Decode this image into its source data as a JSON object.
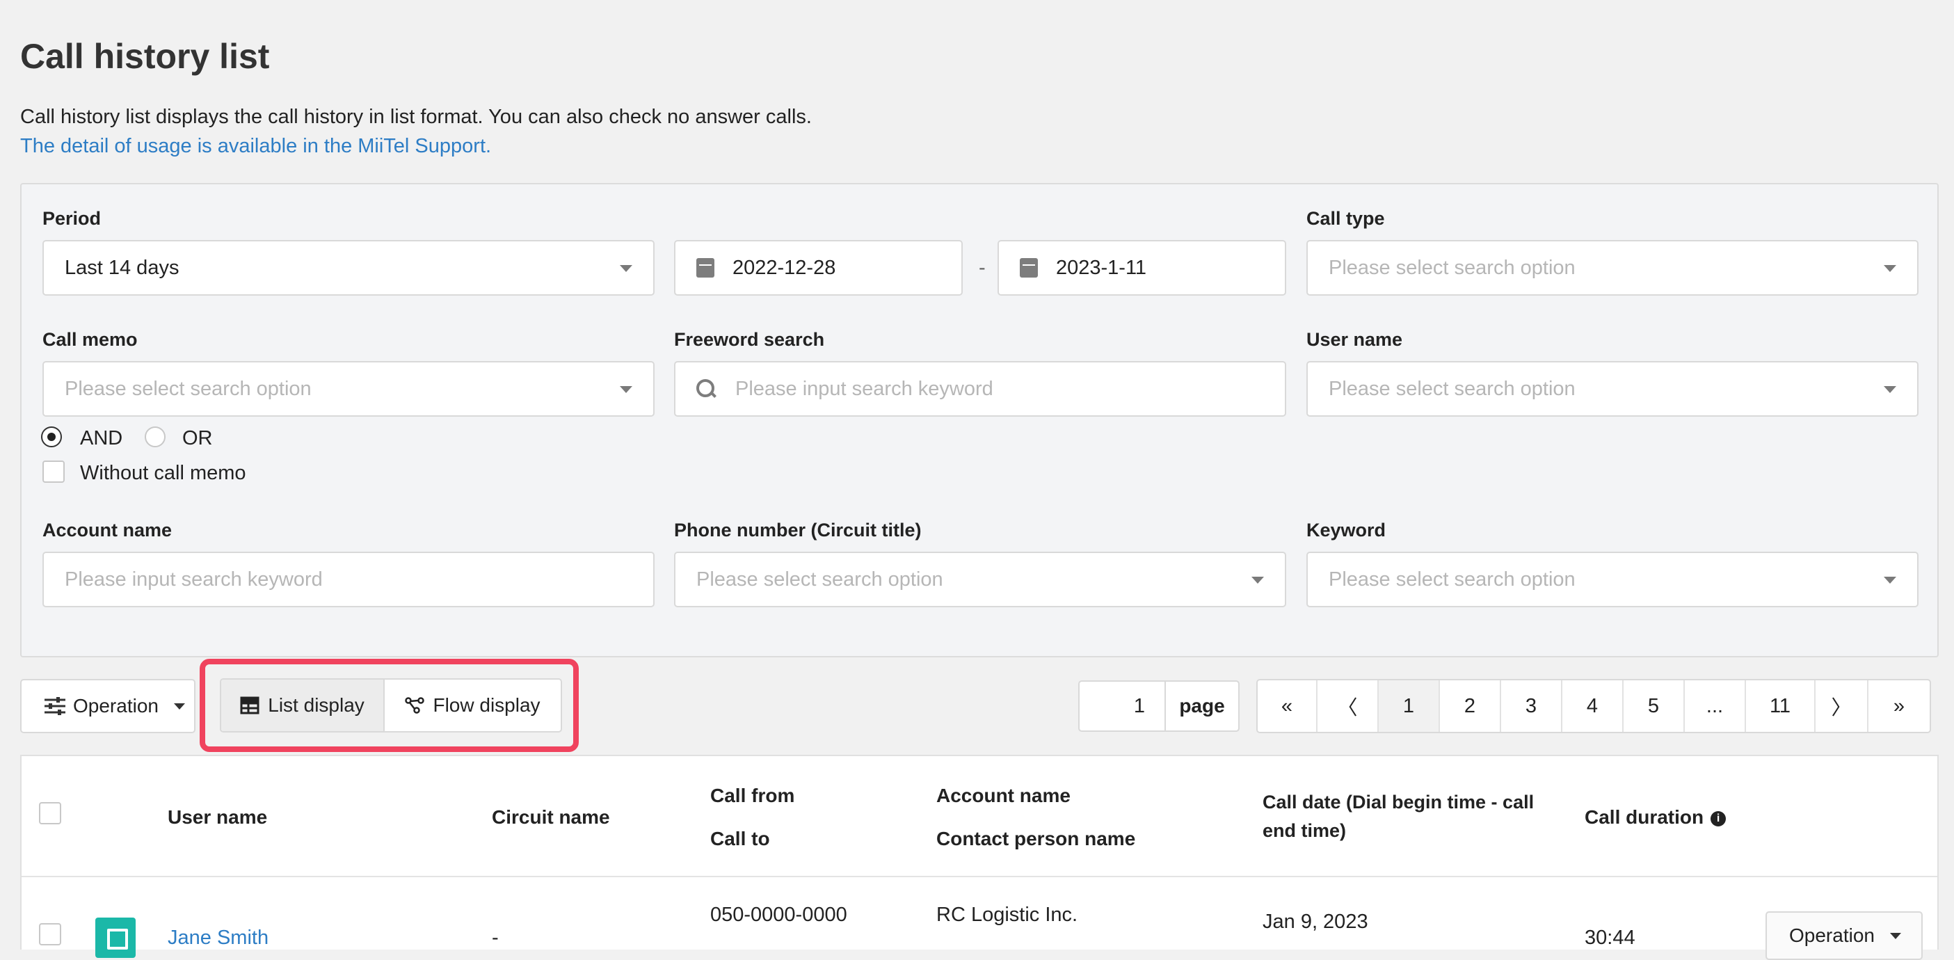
{
  "page": {
    "title": "Call history list",
    "description": "Call history list displays the call history in list format. You can also check no answer calls.",
    "support_link": "The detail of usage is available in the MiiTel Support."
  },
  "filters": {
    "period": {
      "label": "Period",
      "value": "Last 14 days"
    },
    "date_from": "2022-12-28",
    "date_separator": "-",
    "date_to": "2023-1-11",
    "call_type": {
      "label": "Call type",
      "placeholder": "Please select search option"
    },
    "call_memo": {
      "label": "Call memo",
      "placeholder": "Please select search option"
    },
    "freeword": {
      "label": "Freeword search",
      "placeholder": "Please input search keyword"
    },
    "user_name": {
      "label": "User name",
      "placeholder": "Please select search option"
    },
    "logic": {
      "and_label": "AND",
      "or_label": "OR",
      "selected": "AND"
    },
    "without_memo_label": "Without call memo",
    "account_name": {
      "label": "Account name",
      "placeholder": "Please input search keyword"
    },
    "phone_number": {
      "label": "Phone number (Circuit title)",
      "placeholder": "Please select search option"
    },
    "keyword": {
      "label": "Keyword",
      "placeholder": "Please select search option"
    }
  },
  "toolbar": {
    "operation_label": "Operation",
    "list_display_label": "List display",
    "flow_display_label": "Flow display",
    "page_input": "1",
    "page_label": "page",
    "pagination": [
      "«",
      "〈",
      "1",
      "2",
      "3",
      "4",
      "5",
      "...",
      "11",
      "〉",
      "»"
    ],
    "current_page": "1"
  },
  "table": {
    "headers": {
      "user_name": "User name",
      "circuit_name": "Circuit name",
      "call_from": "Call from",
      "call_to": "Call to",
      "account_name": "Account name",
      "contact_person": "Contact person name",
      "call_date": "Call date (Dial begin time - call end time)",
      "call_duration": "Call duration"
    },
    "rows": [
      {
        "user_name": "Jane Smith",
        "circuit_name": "-",
        "call_from": "050-0000-0000",
        "account_name": "RC Logistic Inc.",
        "call_date": "Jan 9, 2023",
        "call_duration": "30:44",
        "operation_label": "Operation"
      }
    ]
  },
  "colors": {
    "accent_link": "#2d7dc5",
    "highlight": "#f0435e",
    "avatar": "#1bb8a8"
  }
}
